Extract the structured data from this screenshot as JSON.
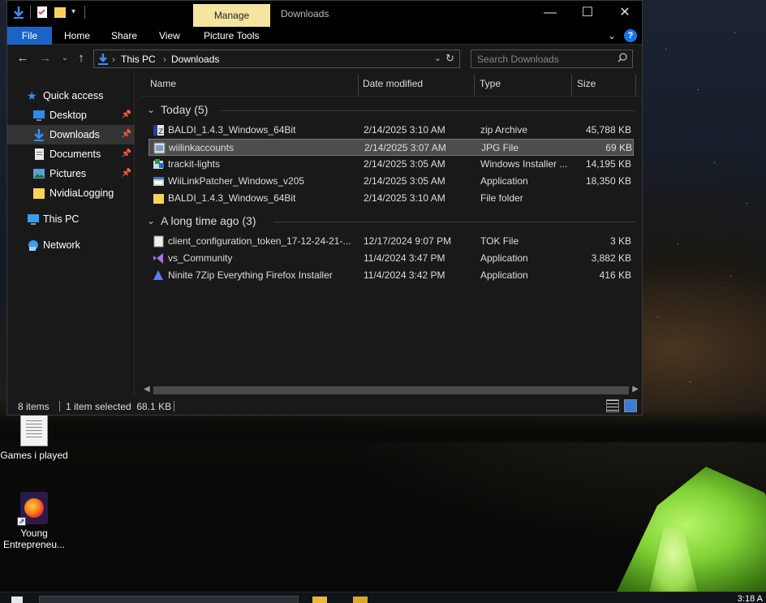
{
  "window": {
    "context_tab": "Manage",
    "title": "Downloads",
    "controls": {
      "minimize": "—",
      "maximize": "☐",
      "close": "✕"
    }
  },
  "ribbon": {
    "tabs": [
      "File",
      "Home",
      "Share",
      "View",
      "Picture Tools"
    ],
    "help": "?"
  },
  "address": {
    "breadcrumb": [
      "This PC",
      "Downloads"
    ],
    "search_placeholder": "Search Downloads"
  },
  "navpane": {
    "quick_access": "Quick access",
    "items": [
      {
        "label": "Desktop",
        "pinned": true
      },
      {
        "label": "Downloads",
        "pinned": true,
        "selected": true
      },
      {
        "label": "Documents",
        "pinned": true
      },
      {
        "label": "Pictures",
        "pinned": true
      },
      {
        "label": "NvidiaLogging",
        "pinned": false
      }
    ],
    "this_pc": "This PC",
    "network": "Network"
  },
  "columns": {
    "name": "Name",
    "date": "Date modified",
    "type": "Type",
    "size": "Size"
  },
  "groups": [
    {
      "label": "Today (5)",
      "files": [
        {
          "name": "BALDI_1.4.3_Windows_64Bit",
          "date": "2/14/2025 3:10 AM",
          "type": "zip Archive",
          "size": "45,788 KB",
          "icon": "zip-archive-icon"
        },
        {
          "name": "wiilinkaccounts",
          "date": "2/14/2025 3:07 AM",
          "type": "JPG File",
          "size": "69 KB",
          "icon": "image-file-icon",
          "selected": true
        },
        {
          "name": "trackit-lights",
          "date": "2/14/2025 3:05 AM",
          "type": "Windows Installer ...",
          "size": "14,195 KB",
          "icon": "installer-icon"
        },
        {
          "name": "WiiLinkPatcher_Windows_v205",
          "date": "2/14/2025 3:05 AM",
          "type": "Application",
          "size": "18,350 KB",
          "icon": "application-icon"
        },
        {
          "name": "BALDI_1.4.3_Windows_64Bit",
          "date": "2/14/2025 3:10 AM",
          "type": "File folder",
          "size": "",
          "icon": "folder-icon"
        }
      ]
    },
    {
      "label": "A long time ago (3)",
      "files": [
        {
          "name": "client_configuration_token_17-12-24-21-...",
          "date": "12/17/2024 9:07 PM",
          "type": "TOK File",
          "size": "3 KB",
          "icon": "blank-file-icon"
        },
        {
          "name": "vs_Community",
          "date": "11/4/2024 3:47 PM",
          "type": "Application",
          "size": "3,882 KB",
          "icon": "visual-studio-icon"
        },
        {
          "name": "Ninite 7Zip Everything Firefox Installer",
          "date": "11/4/2024 3:42 PM",
          "type": "Application",
          "size": "416 KB",
          "icon": "ninite-icon"
        }
      ]
    }
  ],
  "status": {
    "items": "8 items",
    "selection": "1 item selected  68.1 KB"
  },
  "desktop": {
    "icons": [
      {
        "label": "Games i played",
        "icon": "text-document-icon"
      },
      {
        "label": "Young Entrepreneu...",
        "icon": "firefox-shortcut-icon"
      }
    ]
  },
  "taskbar": {
    "clock": "3:18 A"
  }
}
